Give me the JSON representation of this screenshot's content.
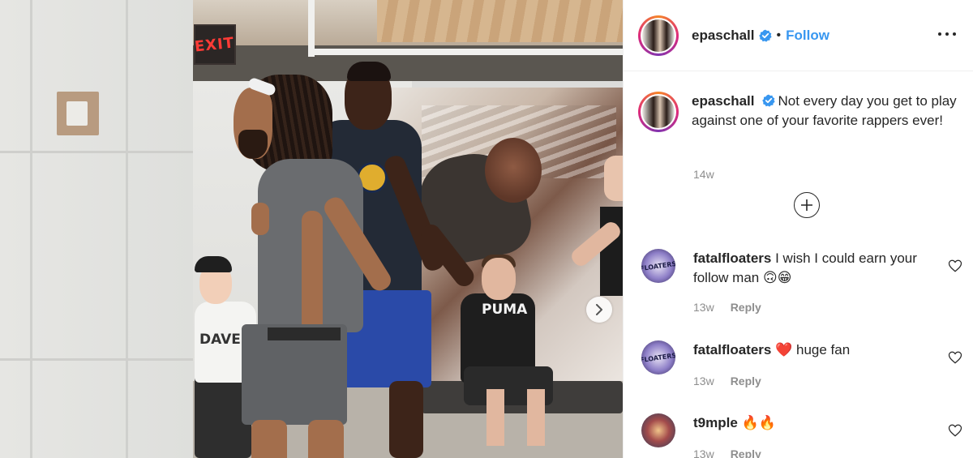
{
  "post": {
    "username": "epaschall",
    "follow_label": "Follow",
    "separator": "•",
    "photo_text": {
      "exit_sign": "EXIT",
      "spectator1_shirt": "DAVE FASE",
      "spectator2_shirt": "PUMA"
    }
  },
  "caption": {
    "username": "epaschall",
    "text": "Not every day you get to play against one of your favorite rappers ever!",
    "time": "14w"
  },
  "comments": [
    {
      "username": "fatalfloaters",
      "text": "I wish I could earn your follow man",
      "emoji": "🙃😁",
      "time": "13w",
      "reply_label": "Reply",
      "avatar_text": "FLOATERS"
    },
    {
      "username": "fatalfloaters",
      "emoji": "❤️",
      "text": "huge fan",
      "time": "13w",
      "reply_label": "Reply",
      "avatar_text": "FLOATERS"
    },
    {
      "username": "t9mple",
      "text": "",
      "emoji": "🔥🔥",
      "time": "13w",
      "reply_label": "Reply"
    }
  ],
  "colors": {
    "accent": "#3897f0",
    "text": "#262626",
    "muted": "#8e8e8e",
    "verified": "#3897f0"
  },
  "icons": {
    "verified": "verified-badge-icon",
    "more": "more-options-icon",
    "next": "chevron-right-icon",
    "load_more": "plus-circle-icon",
    "like": "heart-icon"
  }
}
